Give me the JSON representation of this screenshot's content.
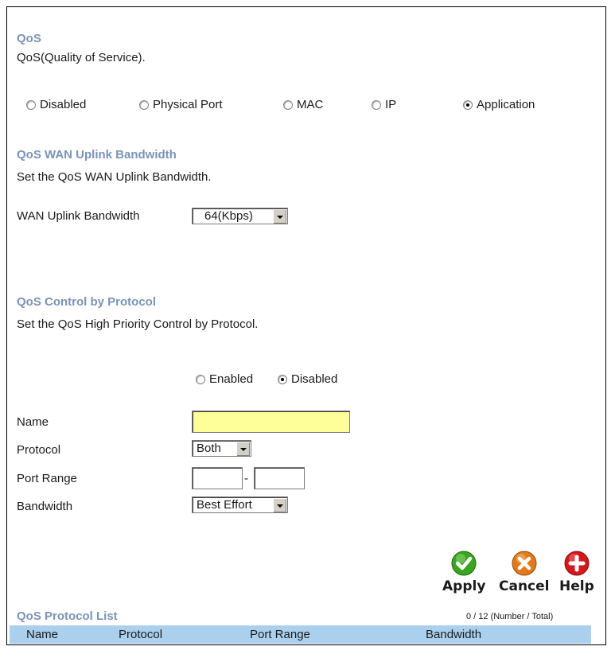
{
  "qos": {
    "heading": "QoS",
    "description": "QoS(Quality of Service).",
    "modes": [
      {
        "label": "Disabled",
        "selected": false
      },
      {
        "label": "Physical Port",
        "selected": false
      },
      {
        "label": "MAC",
        "selected": false
      },
      {
        "label": "IP",
        "selected": false
      },
      {
        "label": "Application",
        "selected": true
      }
    ]
  },
  "wan": {
    "heading": "QoS WAN Uplink Bandwidth",
    "description": "Set the QoS WAN Uplink Bandwidth.",
    "bandwidth_label": "WAN Uplink Bandwidth",
    "bandwidth_value": "64(Kbps)"
  },
  "protocol_control": {
    "heading": "QoS Control by Protocol",
    "description": "Set the QoS High Priority Control by Protocol.",
    "enabled_label": "Enabled",
    "disabled_label": "Disabled",
    "enabled_selected": false,
    "name_label": "Name",
    "name_value": "",
    "protocol_label": "Protocol",
    "protocol_value": "Both",
    "port_range_label": "Port Range",
    "port_range_sep": "-",
    "port_from": "",
    "port_to": "",
    "bandwidth_label": "Bandwidth",
    "bandwidth_value": "Best Effort"
  },
  "actions": {
    "apply_label": "Apply",
    "cancel_label": "Cancel",
    "help_label": "Help",
    "apply_color": "#3aa51e",
    "cancel_color": "#e07a1a",
    "help_color": "#d4181c"
  },
  "list": {
    "heading": "QoS Protocol List",
    "count": "0 / 12 (Number / Total)",
    "columns": [
      "Name",
      "Protocol",
      "Port Range",
      "Bandwidth"
    ],
    "header_color": "#abd0ee"
  }
}
